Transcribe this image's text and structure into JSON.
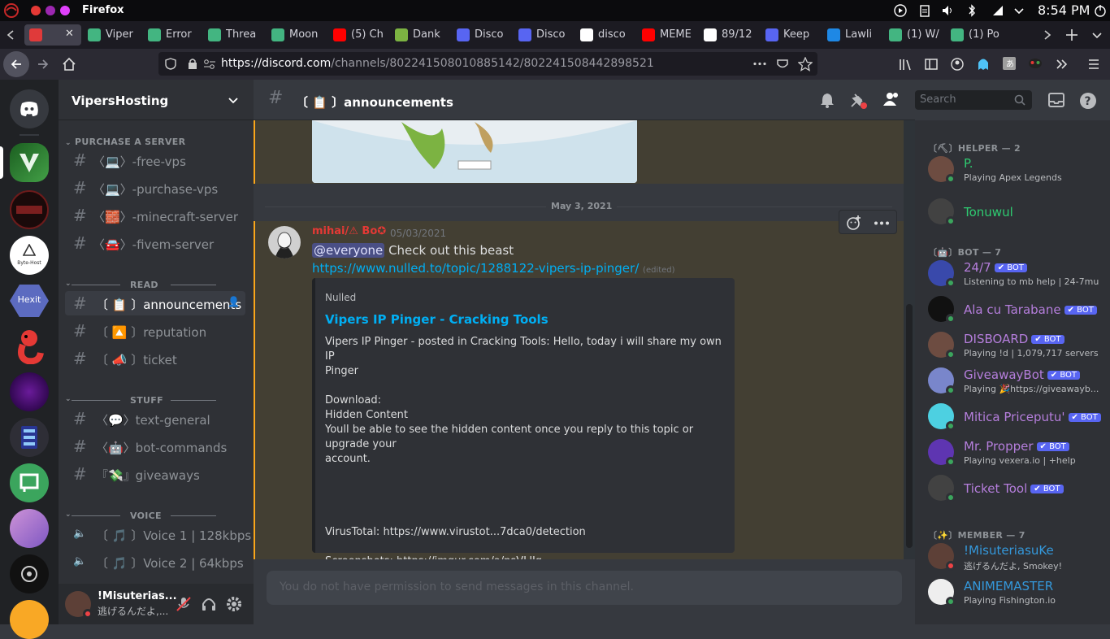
{
  "system": {
    "app_name": "Firefox",
    "clock": "8:54 PM"
  },
  "tabs": [
    {
      "label": "",
      "color": "#e03a3a"
    },
    {
      "label": "Viper",
      "color": "#43b581"
    },
    {
      "label": "Error",
      "color": "#43b581"
    },
    {
      "label": "Threa",
      "color": "#43b581"
    },
    {
      "label": "Moon",
      "color": "#43b581"
    },
    {
      "label": "(5) Ch",
      "color": "#ff0000"
    },
    {
      "label": "Dank",
      "color": "#7cb342"
    },
    {
      "label": "Disco",
      "color": "#5865f2"
    },
    {
      "label": "Disco",
      "color": "#5865f2"
    },
    {
      "label": "disco",
      "color": "#ffffff"
    },
    {
      "label": "MEME",
      "color": "#ff0000"
    },
    {
      "label": "89/12",
      "color": "#ffffff"
    },
    {
      "label": "Keep",
      "color": "#5865f2"
    },
    {
      "label": "Lawli",
      "color": "#1e88e5"
    },
    {
      "label": "(1) W/",
      "color": "#43b581"
    },
    {
      "label": "(1) Po",
      "color": "#43b581"
    }
  ],
  "nav": {
    "url_host": "https://discord.com",
    "url_path": "/channels/802241508010885142/802241508442898521"
  },
  "server": {
    "name": "VipersHosting",
    "categories": [
      {
        "name": "PURCHASE A SERVER",
        "channels": [
          {
            "name": "〈💻〉-free-vps"
          },
          {
            "name": "〈💻〉-purchase-vps"
          },
          {
            "name": "〈🧱〉-minecraft-server"
          },
          {
            "name": "〈🚘〉-fivem-server"
          }
        ]
      },
      {
        "name": "READ",
        "channels": [
          {
            "name": "〔 📋 〕announcements"
          },
          {
            "name": "〔 🔼 〕reputation"
          },
          {
            "name": "〔 📣 〕ticket"
          }
        ]
      },
      {
        "name": "STUFF",
        "channels": [
          {
            "name": "〈💬〉text-general"
          },
          {
            "name": "〈🤖〉bot-commands"
          },
          {
            "name": "『💸』giveaways"
          }
        ]
      },
      {
        "name": "VOICE",
        "channels": [
          {
            "name": "〔 🎵 〕Voice 1 | 128kbps"
          },
          {
            "name": "〔 🎵 〕Voice 2 | 64kbps"
          }
        ]
      }
    ]
  },
  "guild_labels": [
    "Byte-Host",
    "Hexit"
  ],
  "user": {
    "name": "!Misuterias...",
    "status": "逃げるんだよ,..."
  },
  "chat": {
    "channel_title": "〔 📋 〕announcements",
    "search_placeholder": "Search",
    "date_divider": "May 3, 2021",
    "author": "mihai/⚠ Bo✪",
    "timestamp": "05/03/2021",
    "mention": "@everyone",
    "text": " Check out this beast",
    "link": "https://www.nulled.to/topic/1288122-vipers-ip-pinger/",
    "edited": "(edited)",
    "embed": {
      "provider": "Nulled",
      "title": "Vipers IP Pinger - Cracking Tools",
      "lines": [
        "Vipers IP Pinger - posted in Cracking Tools: Hello, today i will share my own IP",
        "Pinger",
        "",
        "Download:",
        "Hidden Content",
        "Youll be able to see the hidden content once you reply to this topic or upgrade your",
        "account.",
        "",
        "",
        "",
        "",
        "VirusTotal: https://www.virustot...7dca0/detection",
        "",
        "Screenshots: https://imgur.com/a/nsVLlIq"
      ]
    },
    "composer_placeholder": "You do not have permission to send messages in this channel."
  },
  "members": {
    "groups": [
      {
        "label": "〔⛏〕HELPER — 2",
        "items": [
          {
            "name": "P.",
            "status": "Playing Apex Legends",
            "color": "#2ecc71",
            "bot": false
          },
          {
            "name": "Tonuwul",
            "status": "",
            "color": "#2ecc71",
            "bot": false
          }
        ]
      },
      {
        "label": "〔🤖〕BOT — 7",
        "items": [
          {
            "name": "24/7",
            "status": "Listening to mb help | 24-7mu...",
            "color": "#b57edc",
            "bot": true
          },
          {
            "name": "Ala cu Tarabane",
            "status": "",
            "color": "#b57edc",
            "bot": true
          },
          {
            "name": "DISBOARD",
            "status": "Playing !d | 1,079,717 servers",
            "color": "#b57edc",
            "bot": true
          },
          {
            "name": "GiveawayBot",
            "status": "Playing 🎉https://giveawayb...",
            "color": "#b57edc",
            "bot": true
          },
          {
            "name": "Mitica Priceputu'",
            "status": "",
            "color": "#b57edc",
            "bot": true
          },
          {
            "name": "Mr. Propper",
            "status": "Playing vexera.io | +help",
            "color": "#b57edc",
            "bot": true
          },
          {
            "name": "Ticket Tool",
            "status": "",
            "color": "#b57edc",
            "bot": true
          }
        ]
      },
      {
        "label": "〔✨〕MEMBER — 7",
        "items": [
          {
            "name": "!MisuteriasuKe",
            "status": "逃げるんだよ, Smokey!",
            "color": "#3498db",
            "bot": false
          },
          {
            "name": "ANIMEMASTER",
            "status": "Playing Fishington.io",
            "color": "#3498db",
            "bot": false
          }
        ]
      }
    ],
    "bot_badge": "✔ BOT"
  }
}
